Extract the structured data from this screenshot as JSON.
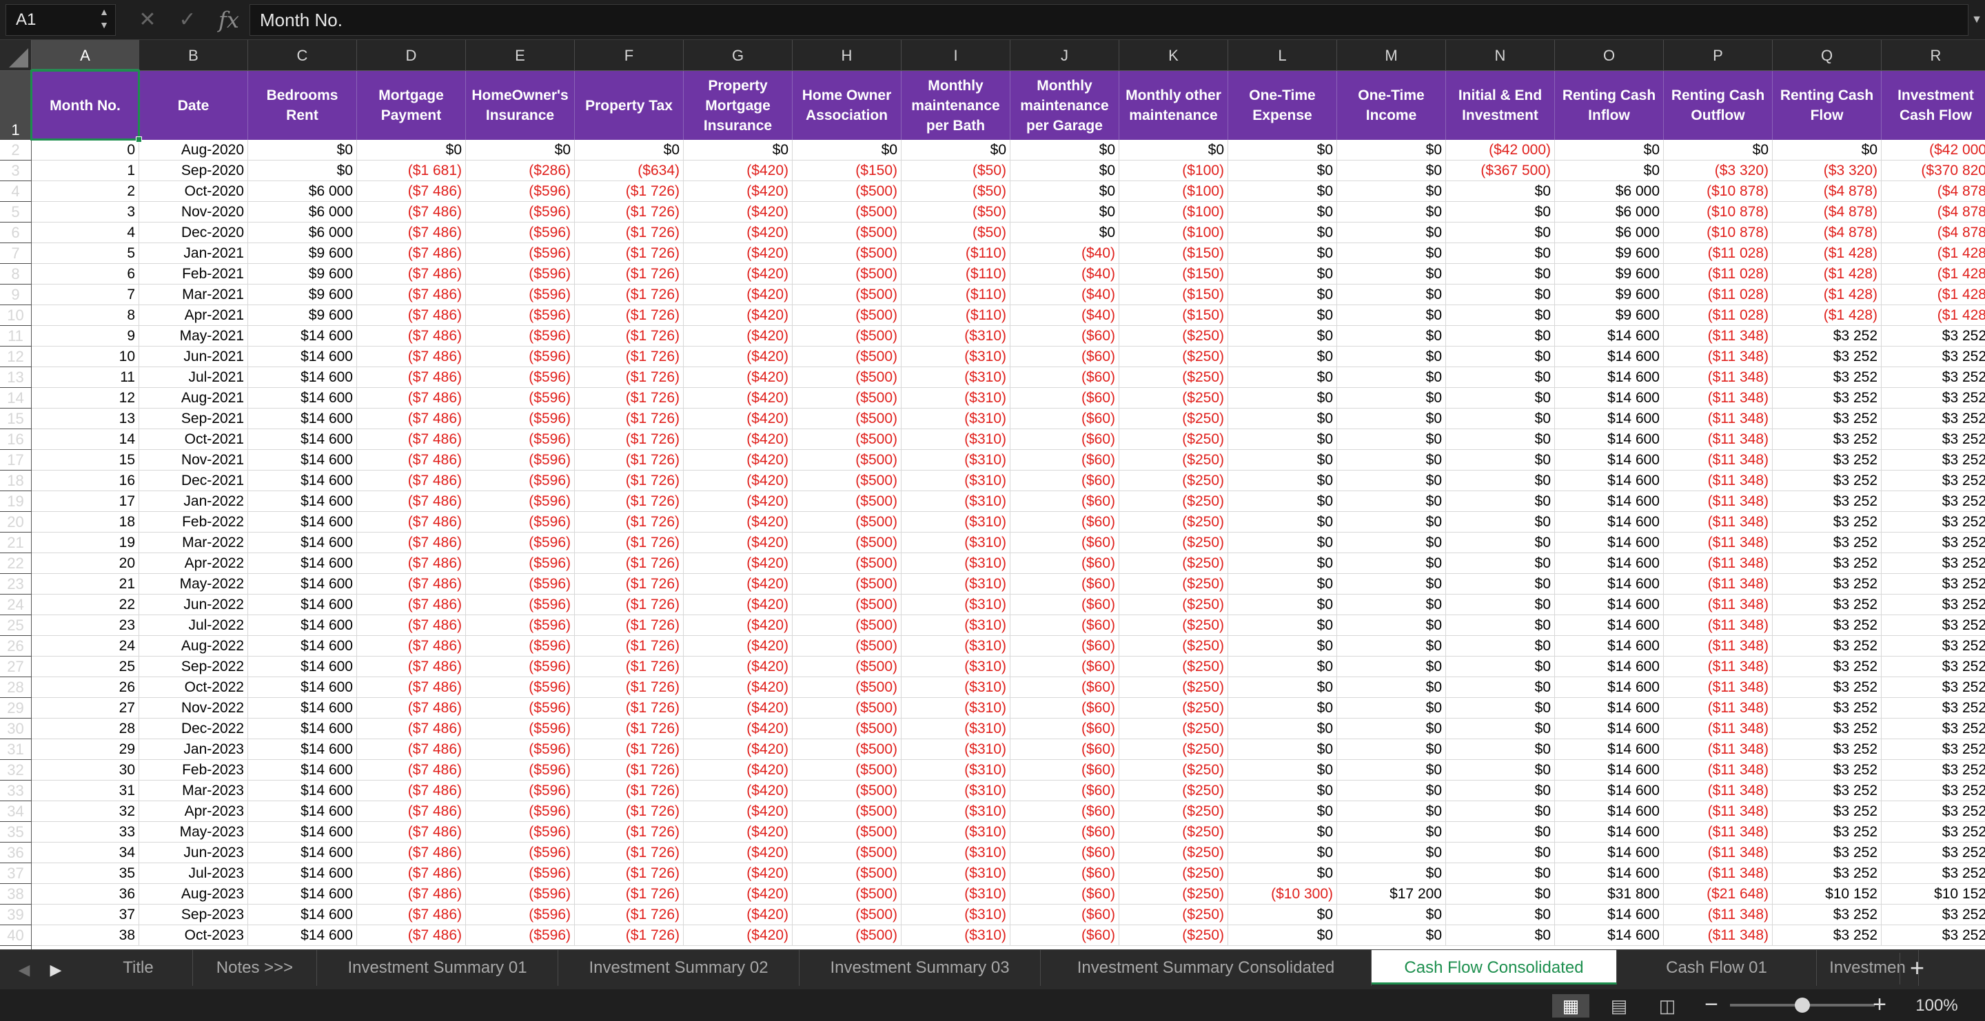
{
  "formula_bar": {
    "cell_ref": "A1",
    "formula": "Month No."
  },
  "icons": {
    "cancel": "close-icon",
    "confirm": "check-icon",
    "function": "fx-icon"
  },
  "columns": [
    "A",
    "B",
    "C",
    "D",
    "E",
    "F",
    "G",
    "H",
    "I",
    "J",
    "K",
    "L",
    "M",
    "N",
    "O",
    "P",
    "Q",
    "R"
  ],
  "headers": [
    "Month No.",
    "Date",
    "Bedrooms Rent",
    "Mortgage Payment",
    "HomeOwner's Insurance",
    "Property Tax",
    "Property Mortgage Insurance",
    "Home Owner Association",
    "Monthly maintenance per Bath",
    "Monthly maintenance per Garage",
    "Monthly other maintenance",
    "One-Time Expense",
    "One-Time Income",
    "Initial & End Investment",
    "Renting Cash Inflow",
    "Renting Cash Outflow",
    "Renting Cash Flow",
    "Investment Cash Flow"
  ],
  "rows": [
    [
      "0",
      "Aug-2020",
      "$0",
      "$0",
      "$0",
      "$0",
      "$0",
      "$0",
      "$0",
      "$0",
      "$0",
      "$0",
      "$0",
      "($42 000)",
      "$0",
      "$0",
      "$0",
      "($42 000"
    ],
    [
      "1",
      "Sep-2020",
      "$0",
      "($1 681)",
      "($286)",
      "($634)",
      "($420)",
      "($150)",
      "($50)",
      "$0",
      "($100)",
      "$0",
      "$0",
      "($367 500)",
      "$0",
      "($3 320)",
      "($3 320)",
      "($370 820"
    ],
    [
      "2",
      "Oct-2020",
      "$6 000",
      "($7 486)",
      "($596)",
      "($1 726)",
      "($420)",
      "($500)",
      "($50)",
      "$0",
      "($100)",
      "$0",
      "$0",
      "$0",
      "$6 000",
      "($10 878)",
      "($4 878)",
      "($4 878"
    ],
    [
      "3",
      "Nov-2020",
      "$6 000",
      "($7 486)",
      "($596)",
      "($1 726)",
      "($420)",
      "($500)",
      "($50)",
      "$0",
      "($100)",
      "$0",
      "$0",
      "$0",
      "$6 000",
      "($10 878)",
      "($4 878)",
      "($4 878"
    ],
    [
      "4",
      "Dec-2020",
      "$6 000",
      "($7 486)",
      "($596)",
      "($1 726)",
      "($420)",
      "($500)",
      "($50)",
      "$0",
      "($100)",
      "$0",
      "$0",
      "$0",
      "$6 000",
      "($10 878)",
      "($4 878)",
      "($4 878"
    ],
    [
      "5",
      "Jan-2021",
      "$9 600",
      "($7 486)",
      "($596)",
      "($1 726)",
      "($420)",
      "($500)",
      "($110)",
      "($40)",
      "($150)",
      "$0",
      "$0",
      "$0",
      "$9 600",
      "($11 028)",
      "($1 428)",
      "($1 428"
    ],
    [
      "6",
      "Feb-2021",
      "$9 600",
      "($7 486)",
      "($596)",
      "($1 726)",
      "($420)",
      "($500)",
      "($110)",
      "($40)",
      "($150)",
      "$0",
      "$0",
      "$0",
      "$9 600",
      "($11 028)",
      "($1 428)",
      "($1 428"
    ],
    [
      "7",
      "Mar-2021",
      "$9 600",
      "($7 486)",
      "($596)",
      "($1 726)",
      "($420)",
      "($500)",
      "($110)",
      "($40)",
      "($150)",
      "$0",
      "$0",
      "$0",
      "$9 600",
      "($11 028)",
      "($1 428)",
      "($1 428"
    ],
    [
      "8",
      "Apr-2021",
      "$9 600",
      "($7 486)",
      "($596)",
      "($1 726)",
      "($420)",
      "($500)",
      "($110)",
      "($40)",
      "($150)",
      "$0",
      "$0",
      "$0",
      "$9 600",
      "($11 028)",
      "($1 428)",
      "($1 428"
    ],
    [
      "9",
      "May-2021",
      "$14 600",
      "($7 486)",
      "($596)",
      "($1 726)",
      "($420)",
      "($500)",
      "($310)",
      "($60)",
      "($250)",
      "$0",
      "$0",
      "$0",
      "$14 600",
      "($11 348)",
      "$3 252",
      "$3 252"
    ],
    [
      "10",
      "Jun-2021",
      "$14 600",
      "($7 486)",
      "($596)",
      "($1 726)",
      "($420)",
      "($500)",
      "($310)",
      "($60)",
      "($250)",
      "$0",
      "$0",
      "$0",
      "$14 600",
      "($11 348)",
      "$3 252",
      "$3 252"
    ],
    [
      "11",
      "Jul-2021",
      "$14 600",
      "($7 486)",
      "($596)",
      "($1 726)",
      "($420)",
      "($500)",
      "($310)",
      "($60)",
      "($250)",
      "$0",
      "$0",
      "$0",
      "$14 600",
      "($11 348)",
      "$3 252",
      "$3 252"
    ],
    [
      "12",
      "Aug-2021",
      "$14 600",
      "($7 486)",
      "($596)",
      "($1 726)",
      "($420)",
      "($500)",
      "($310)",
      "($60)",
      "($250)",
      "$0",
      "$0",
      "$0",
      "$14 600",
      "($11 348)",
      "$3 252",
      "$3 252"
    ],
    [
      "13",
      "Sep-2021",
      "$14 600",
      "($7 486)",
      "($596)",
      "($1 726)",
      "($420)",
      "($500)",
      "($310)",
      "($60)",
      "($250)",
      "$0",
      "$0",
      "$0",
      "$14 600",
      "($11 348)",
      "$3 252",
      "$3 252"
    ],
    [
      "14",
      "Oct-2021",
      "$14 600",
      "($7 486)",
      "($596)",
      "($1 726)",
      "($420)",
      "($500)",
      "($310)",
      "($60)",
      "($250)",
      "$0",
      "$0",
      "$0",
      "$14 600",
      "($11 348)",
      "$3 252",
      "$3 252"
    ],
    [
      "15",
      "Nov-2021",
      "$14 600",
      "($7 486)",
      "($596)",
      "($1 726)",
      "($420)",
      "($500)",
      "($310)",
      "($60)",
      "($250)",
      "$0",
      "$0",
      "$0",
      "$14 600",
      "($11 348)",
      "$3 252",
      "$3 252"
    ],
    [
      "16",
      "Dec-2021",
      "$14 600",
      "($7 486)",
      "($596)",
      "($1 726)",
      "($420)",
      "($500)",
      "($310)",
      "($60)",
      "($250)",
      "$0",
      "$0",
      "$0",
      "$14 600",
      "($11 348)",
      "$3 252",
      "$3 252"
    ],
    [
      "17",
      "Jan-2022",
      "$14 600",
      "($7 486)",
      "($596)",
      "($1 726)",
      "($420)",
      "($500)",
      "($310)",
      "($60)",
      "($250)",
      "$0",
      "$0",
      "$0",
      "$14 600",
      "($11 348)",
      "$3 252",
      "$3 252"
    ],
    [
      "18",
      "Feb-2022",
      "$14 600",
      "($7 486)",
      "($596)",
      "($1 726)",
      "($420)",
      "($500)",
      "($310)",
      "($60)",
      "($250)",
      "$0",
      "$0",
      "$0",
      "$14 600",
      "($11 348)",
      "$3 252",
      "$3 252"
    ],
    [
      "19",
      "Mar-2022",
      "$14 600",
      "($7 486)",
      "($596)",
      "($1 726)",
      "($420)",
      "($500)",
      "($310)",
      "($60)",
      "($250)",
      "$0",
      "$0",
      "$0",
      "$14 600",
      "($11 348)",
      "$3 252",
      "$3 252"
    ],
    [
      "20",
      "Apr-2022",
      "$14 600",
      "($7 486)",
      "($596)",
      "($1 726)",
      "($420)",
      "($500)",
      "($310)",
      "($60)",
      "($250)",
      "$0",
      "$0",
      "$0",
      "$14 600",
      "($11 348)",
      "$3 252",
      "$3 252"
    ],
    [
      "21",
      "May-2022",
      "$14 600",
      "($7 486)",
      "($596)",
      "($1 726)",
      "($420)",
      "($500)",
      "($310)",
      "($60)",
      "($250)",
      "$0",
      "$0",
      "$0",
      "$14 600",
      "($11 348)",
      "$3 252",
      "$3 252"
    ],
    [
      "22",
      "Jun-2022",
      "$14 600",
      "($7 486)",
      "($596)",
      "($1 726)",
      "($420)",
      "($500)",
      "($310)",
      "($60)",
      "($250)",
      "$0",
      "$0",
      "$0",
      "$14 600",
      "($11 348)",
      "$3 252",
      "$3 252"
    ],
    [
      "23",
      "Jul-2022",
      "$14 600",
      "($7 486)",
      "($596)",
      "($1 726)",
      "($420)",
      "($500)",
      "($310)",
      "($60)",
      "($250)",
      "$0",
      "$0",
      "$0",
      "$14 600",
      "($11 348)",
      "$3 252",
      "$3 252"
    ],
    [
      "24",
      "Aug-2022",
      "$14 600",
      "($7 486)",
      "($596)",
      "($1 726)",
      "($420)",
      "($500)",
      "($310)",
      "($60)",
      "($250)",
      "$0",
      "$0",
      "$0",
      "$14 600",
      "($11 348)",
      "$3 252",
      "$3 252"
    ],
    [
      "25",
      "Sep-2022",
      "$14 600",
      "($7 486)",
      "($596)",
      "($1 726)",
      "($420)",
      "($500)",
      "($310)",
      "($60)",
      "($250)",
      "$0",
      "$0",
      "$0",
      "$14 600",
      "($11 348)",
      "$3 252",
      "$3 252"
    ],
    [
      "26",
      "Oct-2022",
      "$14 600",
      "($7 486)",
      "($596)",
      "($1 726)",
      "($420)",
      "($500)",
      "($310)",
      "($60)",
      "($250)",
      "$0",
      "$0",
      "$0",
      "$14 600",
      "($11 348)",
      "$3 252",
      "$3 252"
    ],
    [
      "27",
      "Nov-2022",
      "$14 600",
      "($7 486)",
      "($596)",
      "($1 726)",
      "($420)",
      "($500)",
      "($310)",
      "($60)",
      "($250)",
      "$0",
      "$0",
      "$0",
      "$14 600",
      "($11 348)",
      "$3 252",
      "$3 252"
    ],
    [
      "28",
      "Dec-2022",
      "$14 600",
      "($7 486)",
      "($596)",
      "($1 726)",
      "($420)",
      "($500)",
      "($310)",
      "($60)",
      "($250)",
      "$0",
      "$0",
      "$0",
      "$14 600",
      "($11 348)",
      "$3 252",
      "$3 252"
    ],
    [
      "29",
      "Jan-2023",
      "$14 600",
      "($7 486)",
      "($596)",
      "($1 726)",
      "($420)",
      "($500)",
      "($310)",
      "($60)",
      "($250)",
      "$0",
      "$0",
      "$0",
      "$14 600",
      "($11 348)",
      "$3 252",
      "$3 252"
    ],
    [
      "30",
      "Feb-2023",
      "$14 600",
      "($7 486)",
      "($596)",
      "($1 726)",
      "($420)",
      "($500)",
      "($310)",
      "($60)",
      "($250)",
      "$0",
      "$0",
      "$0",
      "$14 600",
      "($11 348)",
      "$3 252",
      "$3 252"
    ],
    [
      "31",
      "Mar-2023",
      "$14 600",
      "($7 486)",
      "($596)",
      "($1 726)",
      "($420)",
      "($500)",
      "($310)",
      "($60)",
      "($250)",
      "$0",
      "$0",
      "$0",
      "$14 600",
      "($11 348)",
      "$3 252",
      "$3 252"
    ],
    [
      "32",
      "Apr-2023",
      "$14 600",
      "($7 486)",
      "($596)",
      "($1 726)",
      "($420)",
      "($500)",
      "($310)",
      "($60)",
      "($250)",
      "$0",
      "$0",
      "$0",
      "$14 600",
      "($11 348)",
      "$3 252",
      "$3 252"
    ],
    [
      "33",
      "May-2023",
      "$14 600",
      "($7 486)",
      "($596)",
      "($1 726)",
      "($420)",
      "($500)",
      "($310)",
      "($60)",
      "($250)",
      "$0",
      "$0",
      "$0",
      "$14 600",
      "($11 348)",
      "$3 252",
      "$3 252"
    ],
    [
      "34",
      "Jun-2023",
      "$14 600",
      "($7 486)",
      "($596)",
      "($1 726)",
      "($420)",
      "($500)",
      "($310)",
      "($60)",
      "($250)",
      "$0",
      "$0",
      "$0",
      "$14 600",
      "($11 348)",
      "$3 252",
      "$3 252"
    ],
    [
      "35",
      "Jul-2023",
      "$14 600",
      "($7 486)",
      "($596)",
      "($1 726)",
      "($420)",
      "($500)",
      "($310)",
      "($60)",
      "($250)",
      "$0",
      "$0",
      "$0",
      "$14 600",
      "($11 348)",
      "$3 252",
      "$3 252"
    ],
    [
      "36",
      "Aug-2023",
      "$14 600",
      "($7 486)",
      "($596)",
      "($1 726)",
      "($420)",
      "($500)",
      "($310)",
      "($60)",
      "($250)",
      "($10 300)",
      "$17 200",
      "$0",
      "$31 800",
      "($21 648)",
      "$10 152",
      "$10 152"
    ],
    [
      "37",
      "Sep-2023",
      "$14 600",
      "($7 486)",
      "($596)",
      "($1 726)",
      "($420)",
      "($500)",
      "($310)",
      "($60)",
      "($250)",
      "$0",
      "$0",
      "$0",
      "$14 600",
      "($11 348)",
      "$3 252",
      "$3 252"
    ],
    [
      "38",
      "Oct-2023",
      "$14 600",
      "($7 486)",
      "($596)",
      "($1 726)",
      "($420)",
      "($500)",
      "($310)",
      "($60)",
      "($250)",
      "$0",
      "$0",
      "$0",
      "$14 600",
      "($11 348)",
      "$3 252",
      "$3 252"
    ]
  ],
  "sheet_tabs": [
    "Title",
    "Notes >>>",
    "Investment Summary 01",
    "Investment Summary 02",
    "Investment Summary 03",
    "Investment Summary Consolidated",
    "Cash Flow Consolidated",
    "Cash Flow 01",
    "Investmen"
  ],
  "active_tab": "Cash Flow Consolidated",
  "tab_nav": {
    "prev": "◀",
    "next": "▶",
    "add": "+"
  },
  "status_bar": {
    "zoom_level": "100%",
    "zoom_fraction": 0.5,
    "views": [
      "normal-view-icon",
      "page-layout-icon",
      "page-break-icon"
    ]
  },
  "colors": {
    "header_purple": "#6e35a4",
    "negative_red": "#e0201c",
    "selection_green": "#1d8f4e"
  }
}
